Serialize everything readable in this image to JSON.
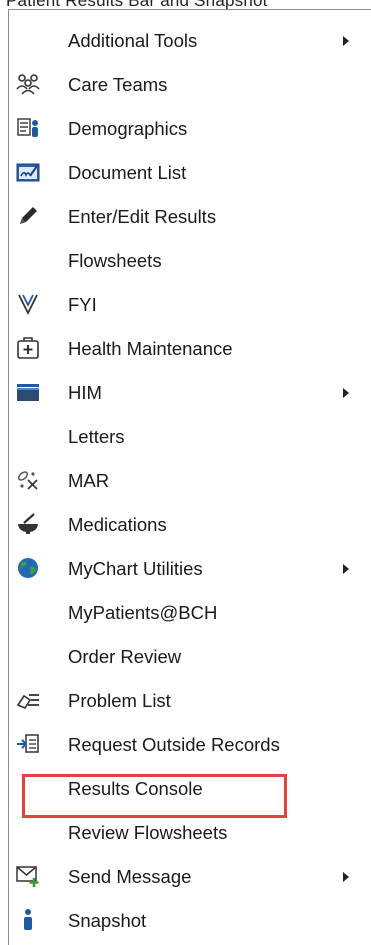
{
  "top_cut_text": "Patient Results Bar and Snapshot",
  "menu": {
    "items": [
      {
        "label": "Additional Tools",
        "icon": "none",
        "submenu": true
      },
      {
        "label": "Care Teams",
        "icon": "care-teams-icon",
        "submenu": false
      },
      {
        "label": "Demographics",
        "icon": "demographics-icon",
        "submenu": false
      },
      {
        "label": "Document List",
        "icon": "document-list-icon",
        "submenu": false
      },
      {
        "label": "Enter/Edit Results",
        "icon": "pencil-icon",
        "submenu": false
      },
      {
        "label": "Flowsheets",
        "icon": "none",
        "submenu": false
      },
      {
        "label": "FYI",
        "icon": "fyi-flag-icon",
        "submenu": false
      },
      {
        "label": "Health Maintenance",
        "icon": "health-maintenance-icon",
        "submenu": false
      },
      {
        "label": "HIM",
        "icon": "him-folder-icon",
        "submenu": true
      },
      {
        "label": "Letters",
        "icon": "none",
        "submenu": false
      },
      {
        "label": "MAR",
        "icon": "mar-icon",
        "submenu": false
      },
      {
        "label": "Medications",
        "icon": "mortar-pestle-icon",
        "submenu": false
      },
      {
        "label": "MyChart Utilities",
        "icon": "globe-icon",
        "submenu": true
      },
      {
        "label": "MyPatients@BCH",
        "icon": "none",
        "submenu": false
      },
      {
        "label": "Order Review",
        "icon": "none",
        "submenu": false
      },
      {
        "label": "Problem List",
        "icon": "problem-list-icon",
        "submenu": false
      },
      {
        "label": "Request Outside Records",
        "icon": "request-records-icon",
        "submenu": false
      },
      {
        "label": "Results Console",
        "icon": "none",
        "submenu": false
      },
      {
        "label": "Review Flowsheets",
        "icon": "none",
        "submenu": false
      },
      {
        "label": "Send Message",
        "icon": "send-message-icon",
        "submenu": true
      },
      {
        "label": "Snapshot",
        "icon": "snapshot-person-icon",
        "submenu": false
      }
    ]
  },
  "highlight_color": "#e0443c"
}
